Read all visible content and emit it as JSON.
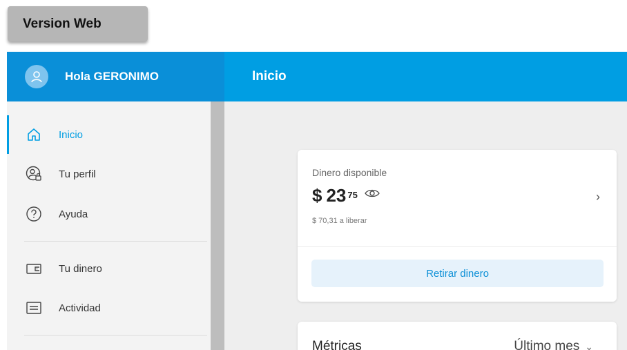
{
  "version_label": "Version Web",
  "header": {
    "greeting": "Hola GERONIMO",
    "page_title": "Inicio"
  },
  "sidebar": {
    "items": [
      {
        "label": "Inicio",
        "icon": "home-icon",
        "active": true
      },
      {
        "label": "Tu perfil",
        "icon": "profile-lock-icon",
        "active": false
      },
      {
        "label": "Ayuda",
        "icon": "help-icon",
        "active": false
      },
      {
        "label": "Tu dinero",
        "icon": "wallet-icon",
        "active": false
      },
      {
        "label": "Actividad",
        "icon": "activity-list-icon",
        "active": false
      }
    ]
  },
  "balance": {
    "label": "Dinero disponible",
    "currency": "$",
    "integer": "23",
    "cents": "75",
    "pending": "$ 70,31 a liberar",
    "withdraw_label": "Retirar dinero"
  },
  "metrics": {
    "title": "Métricas",
    "range": "Último mes"
  },
  "colors": {
    "brand_blue": "#009ee3",
    "brand_blue_dark": "#0a8fd8",
    "button_bg": "#e6f2fb"
  }
}
